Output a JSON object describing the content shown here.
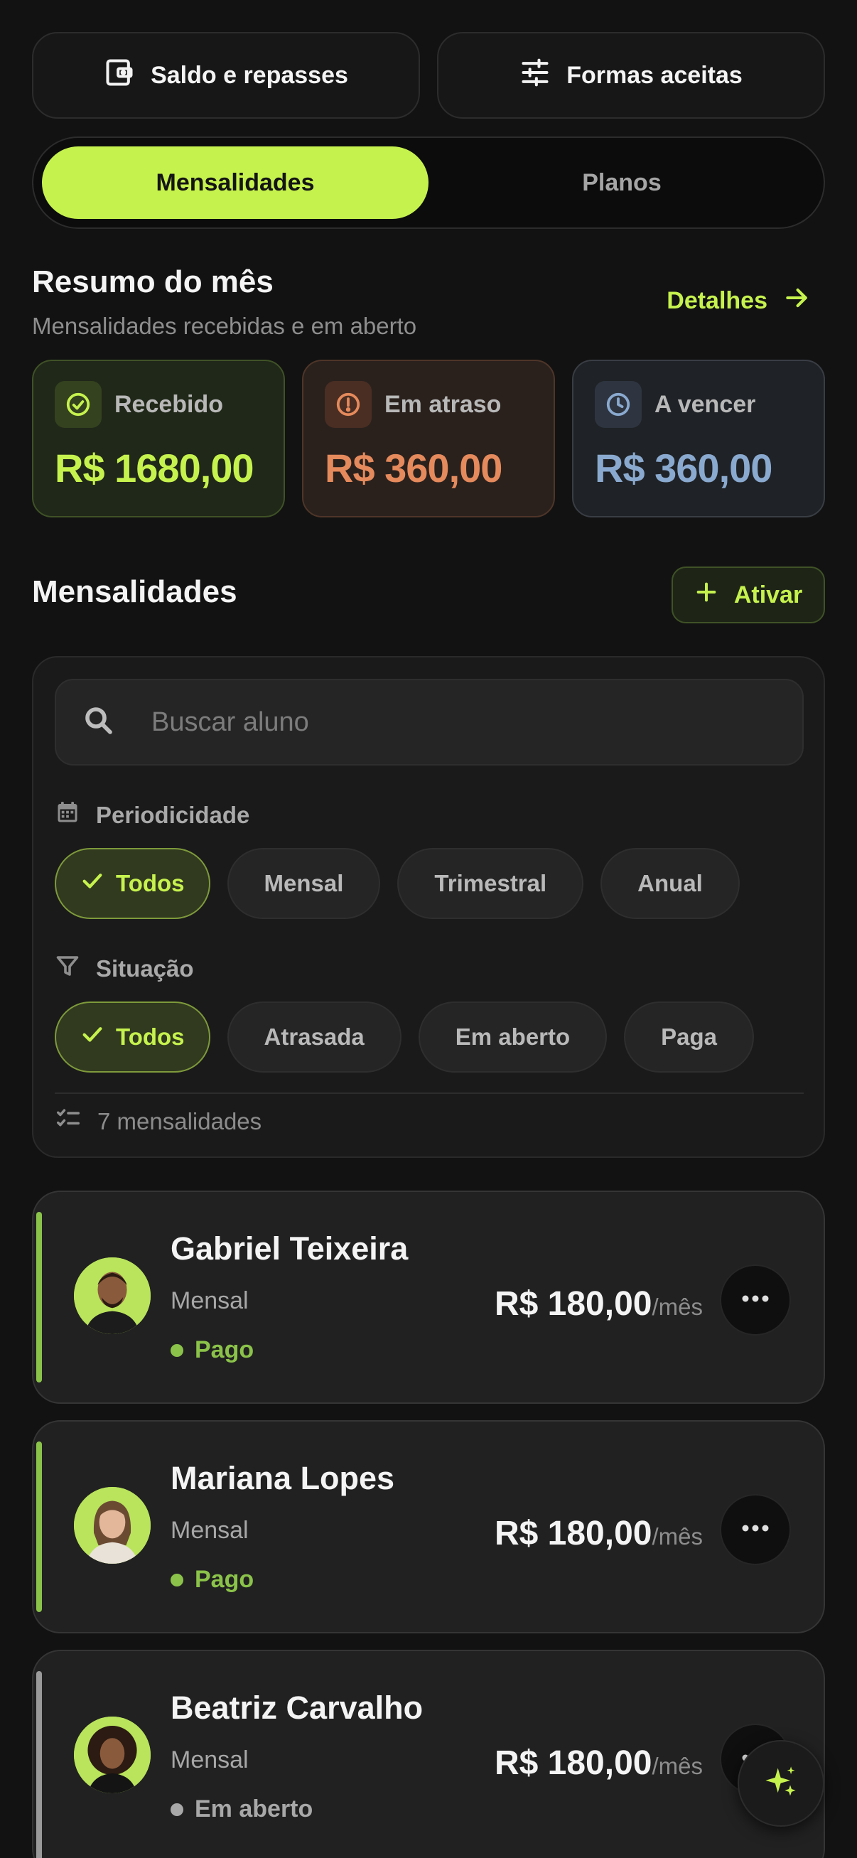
{
  "top_actions": {
    "balance_label": "Saldo e repasses",
    "methods_label": "Formas aceitas"
  },
  "tabs": [
    {
      "label": "Mensalidades",
      "active": true
    },
    {
      "label": "Planos",
      "active": false
    }
  ],
  "summary": {
    "title": "Resumo do mês",
    "subtitle": "Mensalidades recebidas e em aberto",
    "details_label": "Detalhes",
    "cards": [
      {
        "label": "Recebido",
        "value": "R$ 1680,00",
        "icon": "check-circle-icon",
        "color": "#c6f24e"
      },
      {
        "label": "Em atraso",
        "value": "R$ 360,00",
        "icon": "alert-circle-icon",
        "color": "#e58a5c"
      },
      {
        "label": "A vencer",
        "value": "R$ 360,00",
        "icon": "clock-icon",
        "color": "#8aa9cf"
      }
    ]
  },
  "subscriptions": {
    "title": "Mensalidades",
    "activate_label": "Ativar",
    "search_placeholder": "Buscar aluno",
    "periodicity": {
      "label": "Periodicidade",
      "options": [
        "Todos",
        "Mensal",
        "Trimestral",
        "Anual"
      ],
      "selected": "Todos"
    },
    "situation": {
      "label": "Situação",
      "options": [
        "Todos",
        "Atrasada",
        "Em aberto",
        "Paga"
      ],
      "selected": "Todos"
    },
    "count_text": "7 mensalidades"
  },
  "members": [
    {
      "name": "Gabriel Teixeira",
      "period": "Mensal",
      "status": "Pago",
      "status_color": "#8bc34a",
      "price": "R$ 180,00",
      "unit": "/mês"
    },
    {
      "name": "Mariana Lopes",
      "period": "Mensal",
      "status": "Pago",
      "status_color": "#8bc34a",
      "price": "R$ 180,00",
      "unit": "/mês"
    },
    {
      "name": "Beatriz Carvalho",
      "period": "Mensal",
      "status": "Em aberto",
      "status_color": "#a8a8a8",
      "price": "R$ 180,00",
      "unit": "/mês"
    }
  ],
  "colors": {
    "accent": "#c6f24e",
    "background": "#121212"
  }
}
